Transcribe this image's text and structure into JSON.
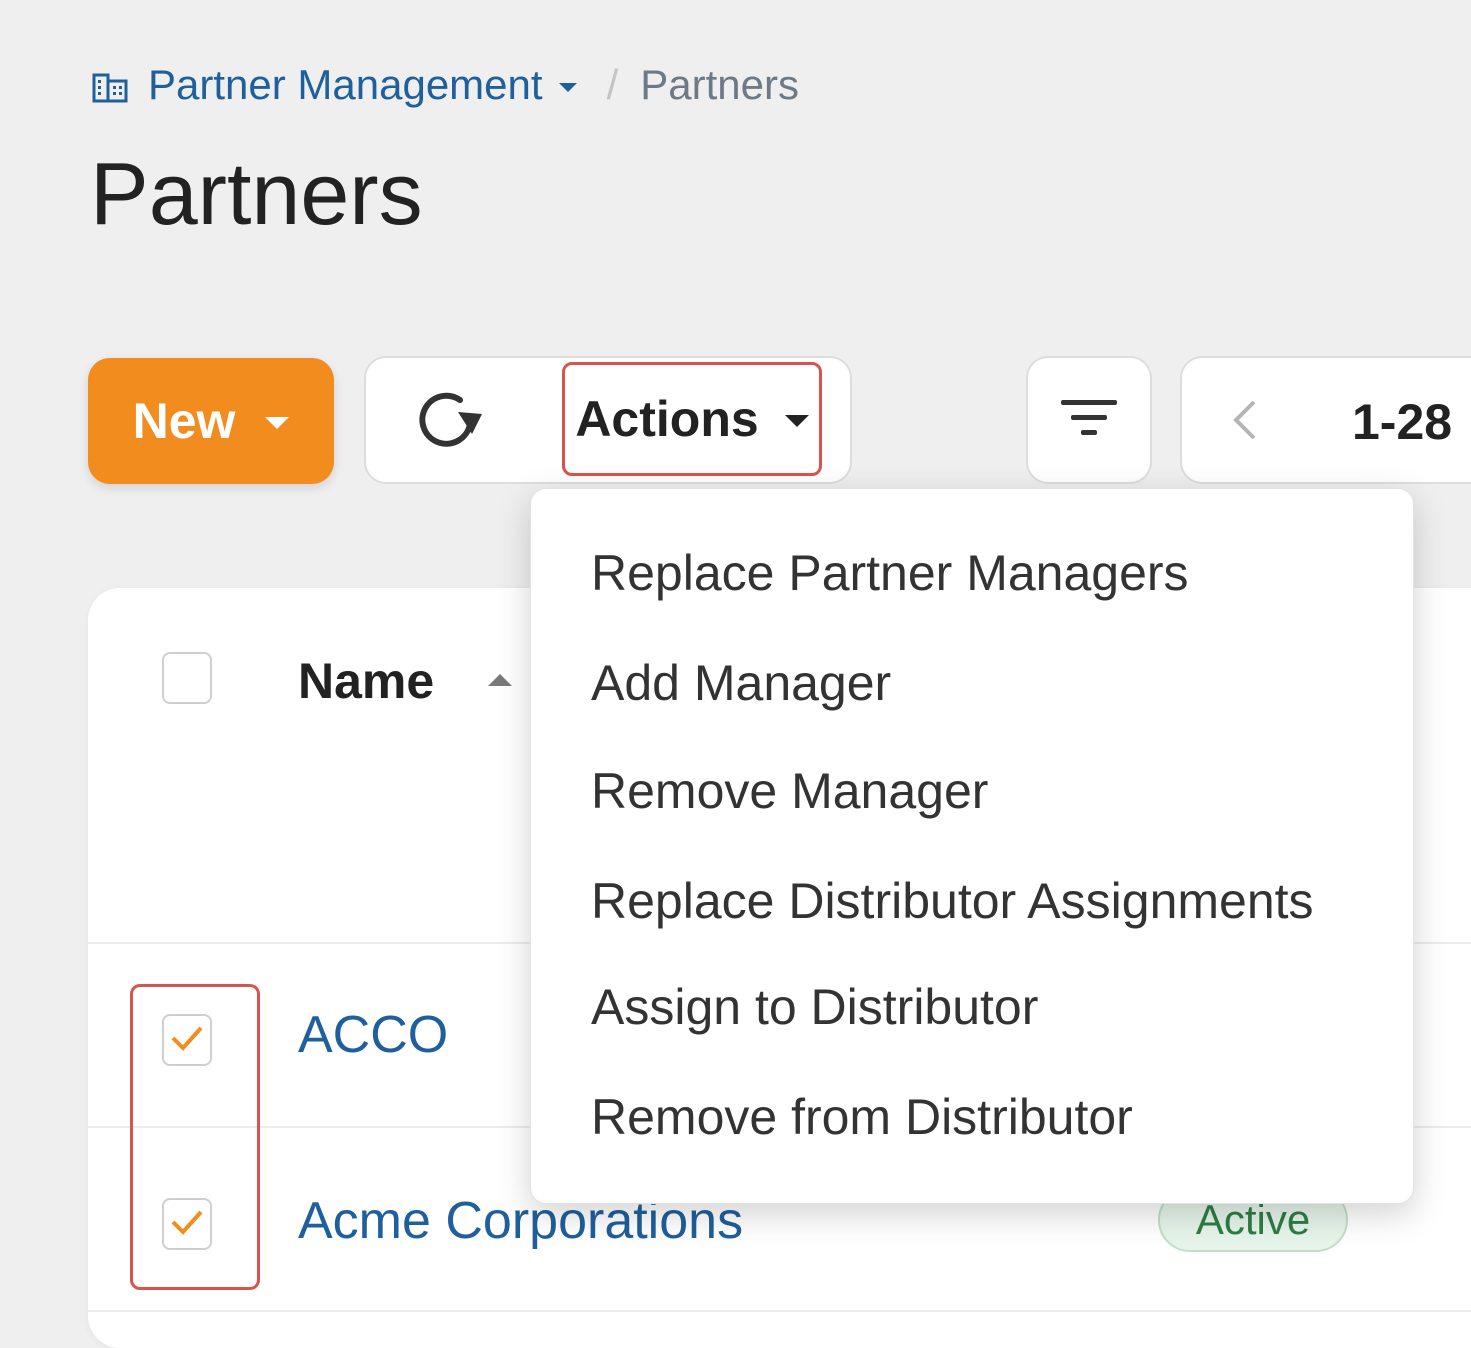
{
  "breadcrumb": {
    "icon": "building-icon",
    "parent_label": "Partner Management",
    "separator": "/",
    "current_label": "Partners"
  },
  "page": {
    "title": "Partners"
  },
  "toolbar": {
    "new_label": "New",
    "refresh_icon": "refresh-icon",
    "actions_label": "Actions",
    "filter_icon": "filter-icon",
    "pager_prev_icon": "chevron-left-icon",
    "pager_range": "1-28"
  },
  "actions_menu": {
    "items": [
      "Replace Partner Managers",
      "Add Manager",
      "Remove Manager",
      "Replace Distributor Assignments",
      "Assign to Distributor",
      "Remove from Distributor"
    ]
  },
  "table": {
    "columns": {
      "name": "Name"
    },
    "rows": [
      {
        "name": "ACCO",
        "checked": true,
        "status": ""
      },
      {
        "name": "Acme Corporations",
        "checked": true,
        "status": "Active"
      }
    ]
  },
  "colors": {
    "accent": "#f28c1e",
    "link": "#1f5f9c",
    "highlight": "#d9534f",
    "status_active": "#2e7d45"
  }
}
